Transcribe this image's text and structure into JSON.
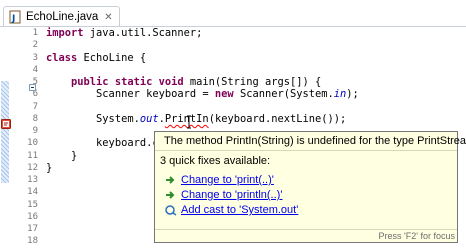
{
  "tab": {
    "filename": "EchoLine.java",
    "close_glyph": "✕",
    "icon": "java-file-icon"
  },
  "code": {
    "line_numbers": [
      "1",
      "2",
      "3",
      "4",
      "5",
      "6",
      "7",
      "8",
      "9",
      "10",
      "11",
      "12",
      "13",
      "14",
      "15",
      "16",
      "17",
      "18"
    ],
    "lines": [
      [
        {
          "t": "import ",
          "c": "kw"
        },
        {
          "t": "java.util.Scanner;"
        }
      ],
      [],
      [
        {
          "t": "class ",
          "c": "kw"
        },
        {
          "t": "EchoLine {"
        }
      ],
      [],
      [
        {
          "t": "    "
        },
        {
          "t": "public static void ",
          "c": "kw"
        },
        {
          "t": "main(String args[]) {"
        }
      ],
      [
        {
          "t": "        Scanner keyboard = "
        },
        {
          "t": "new ",
          "c": "kw"
        },
        {
          "t": "Scanner(System."
        },
        {
          "t": "in",
          "c": "fld"
        },
        {
          "t": ");"
        }
      ],
      [],
      [
        {
          "t": "        System."
        },
        {
          "t": "out",
          "c": "fld"
        },
        {
          "t": "."
        },
        {
          "t": "PrintIn",
          "c": "err"
        },
        {
          "t": "(keyboard.nextLine());"
        }
      ],
      [],
      [
        {
          "t": "        keyboard.cl"
        }
      ],
      [
        {
          "t": "    }"
        }
      ],
      [
        {
          "t": "}"
        }
      ],
      [],
      [],
      [],
      [],
      [],
      []
    ]
  },
  "popup": {
    "error_message": "The method PrintIn(String) is undefined for the type PrintStream",
    "fixes_heading": "3 quick fixes available:",
    "fixes": [
      {
        "label": "Change to 'print(..)'",
        "icon": "rename-arrow-icon"
      },
      {
        "label": "Change to 'println(..)'",
        "icon": "rename-arrow-icon"
      },
      {
        "label": "Add cast to 'System.out'",
        "icon": "cast-icon"
      }
    ],
    "footer": "Press 'F2' for focus"
  },
  "colors": {
    "keyword": "#7f0055",
    "field": "#0000c0",
    "error": "#ff0000",
    "link": "#0000ee",
    "popup_bg": "#ffffe1"
  }
}
